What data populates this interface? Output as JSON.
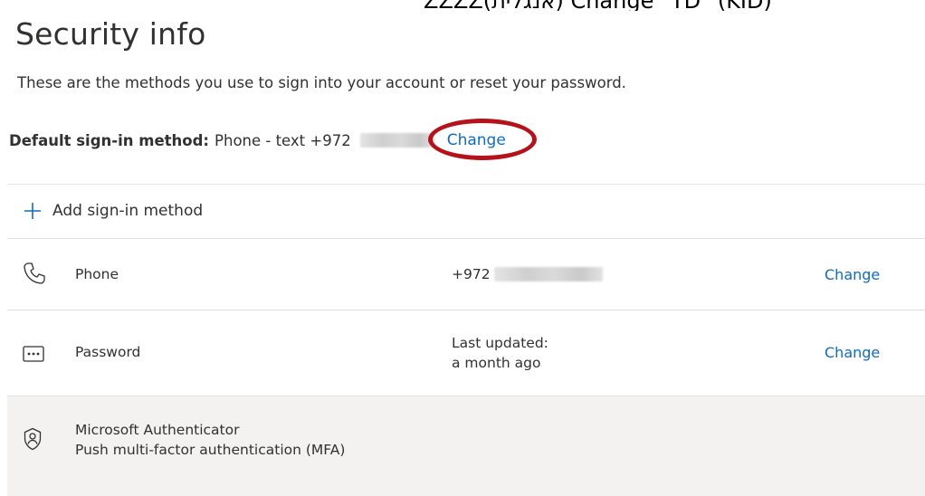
{
  "caption": {
    "text": "‫(KID) \"Change\" TD (אנגלית)ZZZZ"
  },
  "header": {
    "title": "Security info",
    "subtitle": "These are the methods you use to sign into your account or reset your password."
  },
  "default_method": {
    "label": "Default sign-in method:",
    "value": "Phone - text +972",
    "change_label": "Change"
  },
  "add_method": {
    "label": "Add sign-in method",
    "icon": "plus-icon"
  },
  "methods": [
    {
      "name": "Phone",
      "icon": "phone-icon",
      "detail": "+972",
      "action": "Change"
    },
    {
      "name": "Password",
      "icon": "password-icon",
      "detail_line1": "Last updated:",
      "detail_line2": "a month ago",
      "action": "Change"
    },
    {
      "name": "Microsoft Authenticator",
      "subtitle": "Push multi-factor authentication (MFA)",
      "icon": "authenticator-icon"
    }
  ],
  "colors": {
    "accent": "#0f6cbd",
    "highlight_oval": "#b4131c",
    "row_hover": "#f3f2f1"
  }
}
